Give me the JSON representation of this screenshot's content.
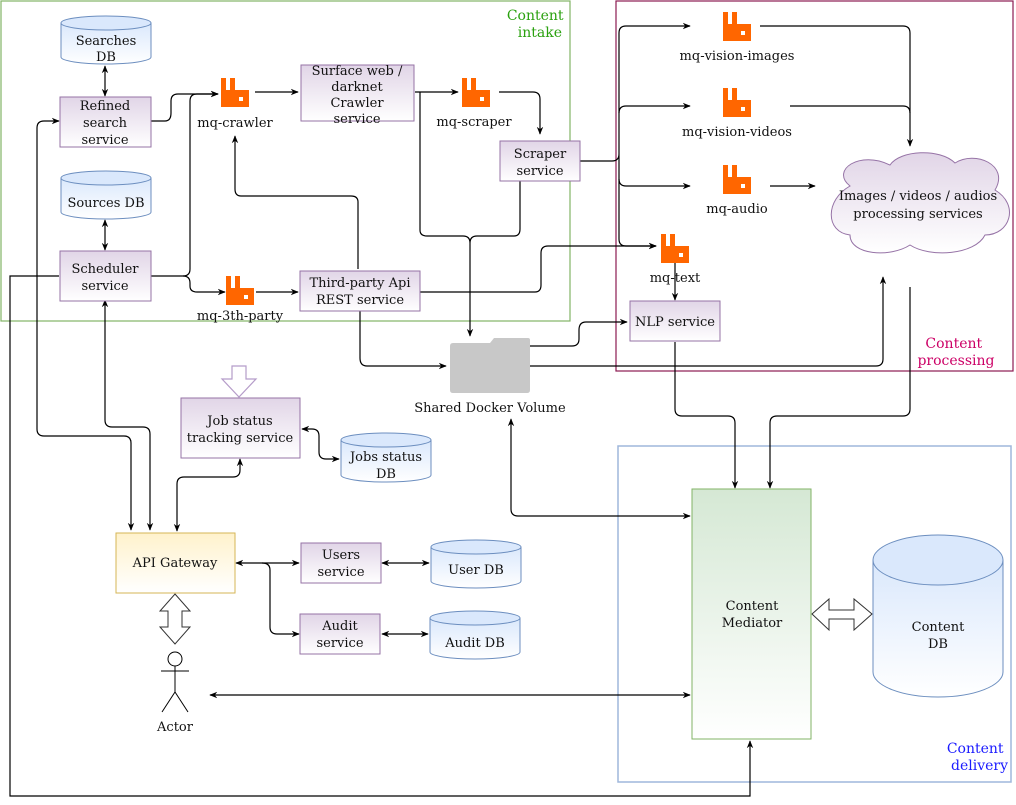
{
  "groups": {
    "intake": {
      "label_lines": [
        "Content",
        "intake"
      ],
      "color": "#2aa10f",
      "border": "#82b366"
    },
    "processing": {
      "label_lines": [
        "Content",
        "processing"
      ],
      "color": "#cc0066",
      "border": "#8b1a52"
    },
    "delivery": {
      "label_lines": [
        "Content",
        "delivery"
      ],
      "color": "#1a1aff",
      "border": "#7f9fd0"
    }
  },
  "databases": {
    "searches": {
      "lines": [
        "Searches",
        "DB"
      ]
    },
    "sources": {
      "lines": [
        "Sources DB"
      ]
    },
    "jobs_status": {
      "lines": [
        "Jobs status",
        "DB"
      ]
    },
    "user": {
      "lines": [
        "User DB"
      ]
    },
    "audit": {
      "lines": [
        "Audit DB"
      ]
    },
    "content": {
      "lines": [
        "Content",
        "DB"
      ]
    }
  },
  "services": {
    "refined_search": {
      "lines": [
        "Refined",
        "search",
        "service"
      ]
    },
    "scheduler": {
      "lines": [
        "Scheduler",
        "service"
      ]
    },
    "crawler": {
      "lines": [
        "Surface web /",
        "darknet",
        "Crawler",
        "service"
      ]
    },
    "third_party": {
      "lines": [
        "Third-party Api",
        "REST service"
      ]
    },
    "scraper": {
      "lines": [
        "Scraper",
        "service"
      ]
    },
    "nlp": {
      "lines": [
        "NLP service"
      ]
    },
    "job_status": {
      "lines": [
        "Job status",
        "tracking service"
      ]
    },
    "users": {
      "lines": [
        "Users",
        "service"
      ]
    },
    "audit": {
      "lines": [
        "Audit",
        "service"
      ]
    },
    "api_gateway": {
      "lines": [
        "API Gateway"
      ]
    },
    "content_mediator": {
      "lines": [
        "Content",
        "Mediator"
      ]
    },
    "media_processing": {
      "lines": [
        "Images / videos / audios",
        "processing services"
      ]
    }
  },
  "queues": {
    "crawler": {
      "label": "mq-crawler"
    },
    "scraper": {
      "label": "mq-scraper"
    },
    "third_party": {
      "label": "mq-3th-party"
    },
    "vision_images": {
      "label": "mq-vision-images"
    },
    "vision_videos": {
      "label": "mq-vision-videos"
    },
    "audio": {
      "label": "mq-audio"
    },
    "text": {
      "label": "mq-text"
    }
  },
  "volume": {
    "label": "Shared Docker Volume"
  },
  "actor": {
    "label": "Actor"
  },
  "colors": {
    "queue_icon": "#ff6600",
    "service_fill_top": "#e1d5e7",
    "service_border": "#9673a6",
    "db_fill_top": "#dae8fc",
    "db_border": "#6c8ebf",
    "gateway_fill_top": "#fff2cc",
    "gateway_border": "#d6b656",
    "mediator_fill_top": "#d5e8d4",
    "mediator_border": "#82b366",
    "folder": "#c8c8c8"
  }
}
